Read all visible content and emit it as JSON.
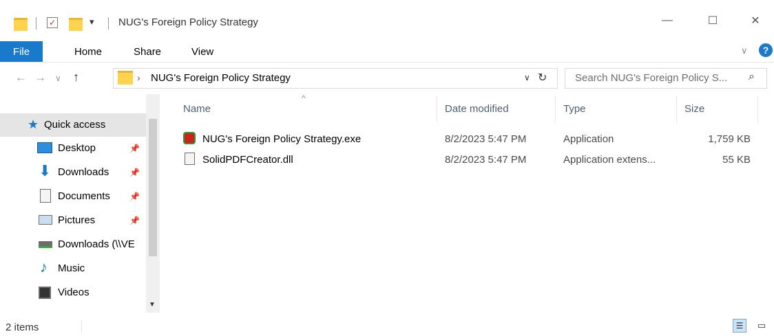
{
  "window": {
    "title": "NUG's Foreign Policy Strategy",
    "minimize": "—",
    "maximize": "☐",
    "close": "✕",
    "help": "?"
  },
  "ribbon": {
    "tabs": [
      "File",
      "Home",
      "Share",
      "View"
    ],
    "accent": "#1979ca"
  },
  "address": {
    "path": "NUG's Foreign Policy Strategy",
    "search_placeholder": "Search NUG's Foreign Policy S..."
  },
  "nav": {
    "quick_access": "Quick access",
    "items": [
      {
        "label": "Desktop",
        "icon": "desktop-icon",
        "pinned": true
      },
      {
        "label": "Downloads",
        "icon": "downloads-icon",
        "pinned": true
      },
      {
        "label": "Documents",
        "icon": "documents-icon",
        "pinned": true
      },
      {
        "label": "Pictures",
        "icon": "pictures-icon",
        "pinned": true
      },
      {
        "label": "Downloads (\\\\VE",
        "icon": "network-drive-icon",
        "pinned": false
      },
      {
        "label": "Music",
        "icon": "music-icon",
        "pinned": false
      },
      {
        "label": "Videos",
        "icon": "videos-icon",
        "pinned": false
      }
    ]
  },
  "columns": {
    "name": "Name",
    "date": "Date modified",
    "type": "Type",
    "size": "Size"
  },
  "files": [
    {
      "name": "NUG's Foreign Policy Strategy.exe",
      "date": "8/2/2023 5:47 PM",
      "type": "Application",
      "size": "1,759 KB",
      "icon": "exe-icon"
    },
    {
      "name": "SolidPDFCreator.dll",
      "date": "8/2/2023 5:47 PM",
      "type": "Application extens...",
      "size": "55 KB",
      "icon": "dll-icon"
    }
  ],
  "status": {
    "count": "2 items"
  }
}
